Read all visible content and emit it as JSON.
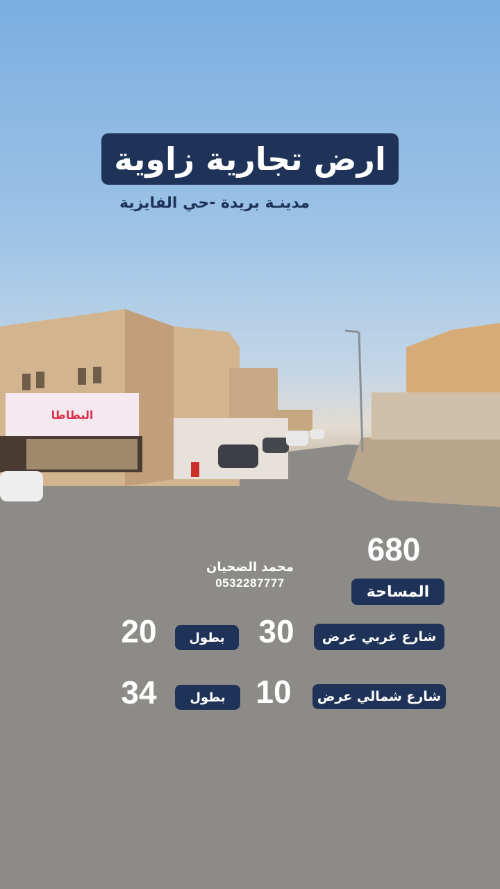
{
  "listing": {
    "title": "ارض تجارية زاوية",
    "location": "مدينـة بريدة -حي الفايزية",
    "area_value": "680",
    "area_label": "المساحة",
    "west_street_label": "شارع غربي عرض",
    "west_street_width": "30",
    "west_length_label": "بطول",
    "west_length": "20",
    "north_street_label": "شارع شمالي عرض",
    "north_street_width": "10",
    "north_length_label": "بطول",
    "north_length": "34"
  },
  "agent": {
    "name": "محمد الضحيان",
    "phone": "0532287777"
  },
  "scene": {
    "shop_sign": "البطاطا"
  },
  "colors": {
    "label_background": "#1f3358",
    "text_light": "#ffffff"
  }
}
